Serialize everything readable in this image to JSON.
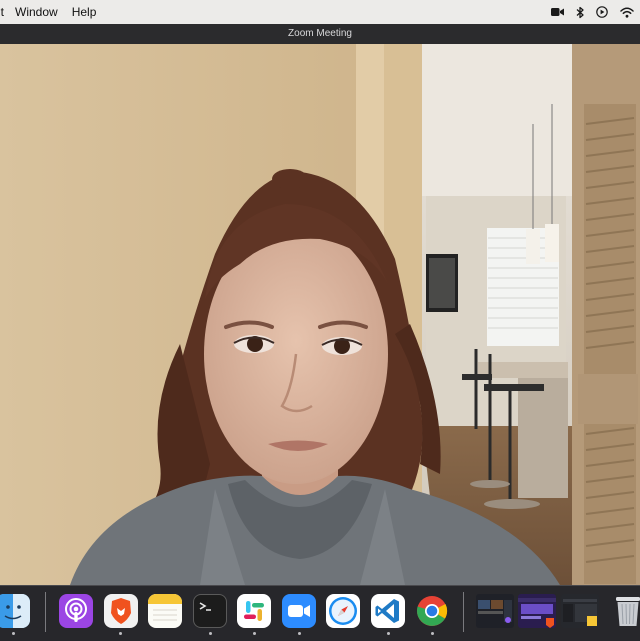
{
  "menubar": {
    "items": [
      "it",
      "Window",
      "Help"
    ]
  },
  "window": {
    "title": "Zoom Meeting"
  },
  "status_icons": [
    "video-camera-icon",
    "bluetooth-icon",
    "play-circle-icon",
    "wifi-icon"
  ],
  "dock": {
    "apps": [
      {
        "name": "Finder",
        "icon": "finder-icon"
      },
      {
        "name": "Podcasts",
        "icon": "podcasts-icon"
      },
      {
        "name": "Brave Browser",
        "icon": "brave-icon"
      },
      {
        "name": "Notes",
        "icon": "notes-icon"
      },
      {
        "name": "Terminal",
        "icon": "terminal-icon"
      },
      {
        "name": "Slack",
        "icon": "slack-icon"
      },
      {
        "name": "Zoom",
        "icon": "zoom-icon"
      },
      {
        "name": "Safari",
        "icon": "safari-icon"
      },
      {
        "name": "Visual Studio Code",
        "icon": "vscode-icon"
      },
      {
        "name": "Google Chrome",
        "icon": "chrome-icon"
      }
    ],
    "minimized": [
      "window-thumbnail",
      "window-thumbnail",
      "window-thumbnail"
    ],
    "trash": {
      "name": "Trash",
      "icon": "trash-icon"
    }
  }
}
